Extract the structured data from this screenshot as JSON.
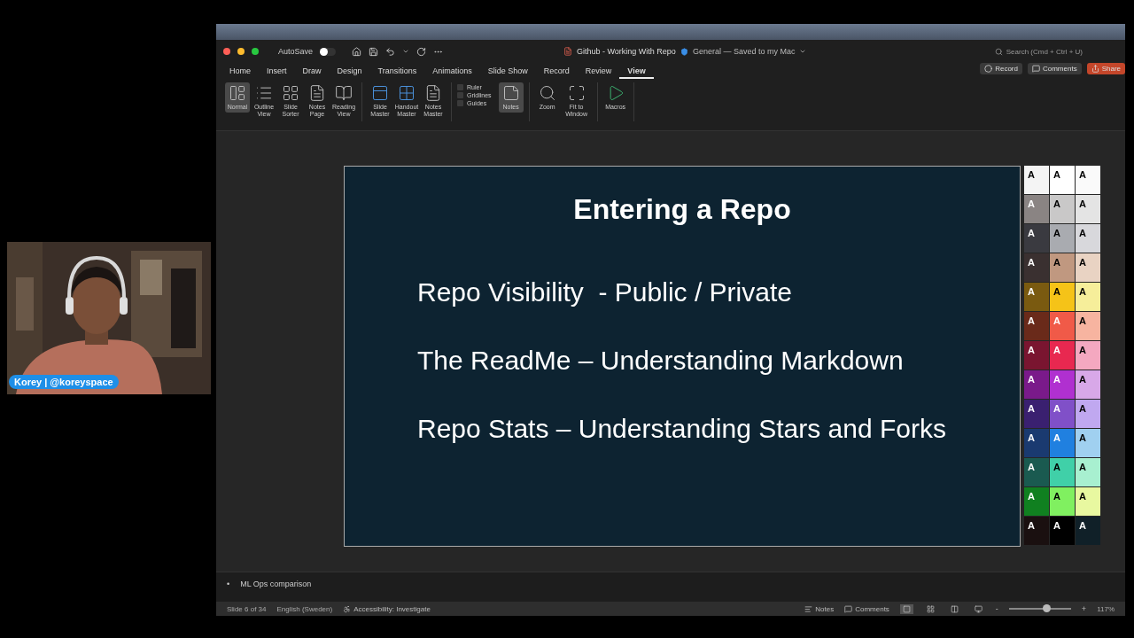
{
  "webcam": {
    "name_tag": "Korey | @koreyspace"
  },
  "window": {
    "title": "Github - Working With Repo",
    "location": "General — Saved to my Mac"
  },
  "autosave": {
    "label": "AutoSave",
    "on": false
  },
  "search": {
    "placeholder": "Search (Cmd + Ctrl + U)"
  },
  "actions": [
    {
      "label": "Record",
      "kind": "record"
    },
    {
      "label": "Comments",
      "kind": "comments"
    },
    {
      "label": "Share",
      "kind": "share"
    }
  ],
  "menu_tabs": [
    {
      "label": "Home",
      "selected": false
    },
    {
      "label": "Insert",
      "selected": false
    },
    {
      "label": "Draw",
      "selected": false
    },
    {
      "label": "Design",
      "selected": false
    },
    {
      "label": "Transitions",
      "selected": false
    },
    {
      "label": "Animations",
      "selected": false
    },
    {
      "label": "Slide Show",
      "selected": false
    },
    {
      "label": "Record",
      "selected": false
    },
    {
      "label": "Review",
      "selected": false
    },
    {
      "label": "View",
      "selected": true
    }
  ],
  "ribbon": [
    [
      {
        "kind": "button",
        "label": "Normal",
        "selected": true
      },
      {
        "kind": "button",
        "label": "Outline View",
        "selected": false
      },
      {
        "kind": "button",
        "label": "Slide Sorter",
        "selected": false
      },
      {
        "kind": "button",
        "label": "Notes Page",
        "selected": false
      },
      {
        "kind": "button",
        "label": "Reading View",
        "selected": false
      }
    ],
    [
      {
        "kind": "button",
        "label": "Slide Master",
        "selected": false
      },
      {
        "kind": "button",
        "label": "Handout Master",
        "selected": false
      },
      {
        "kind": "button",
        "label": "Notes Master",
        "selected": false
      }
    ],
    [
      {
        "kind": "checks",
        "items": [
          {
            "label": "Ruler",
            "checked": false
          },
          {
            "label": "Gridlines",
            "checked": false
          },
          {
            "label": "Guides",
            "checked": false
          }
        ]
      },
      {
        "kind": "button",
        "label": "Notes",
        "selected": true
      }
    ],
    [
      {
        "kind": "button",
        "label": "Zoom",
        "selected": false
      },
      {
        "kind": "button",
        "label": "Fit to Window",
        "selected": false
      }
    ],
    [
      {
        "kind": "button",
        "label": "Macros",
        "selected": false
      }
    ]
  ],
  "slide": {
    "title": "Entering a Repo",
    "bullets": [
      "Repo Visibility  - Public / Private",
      "The ReadMe – Understanding Markdown",
      "Repo Stats – Understanding Stars and Forks"
    ]
  },
  "swatch_rows": [
    [
      {
        "color": "#f4f4f4",
        "letter": "A"
      },
      {
        "color": "#ffffff",
        "letter": "A"
      },
      {
        "color": "#fafafa",
        "letter": "A"
      }
    ],
    [
      {
        "color": "#8a8483",
        "letter": "A"
      },
      {
        "color": "#c9c8c8",
        "letter": "A"
      },
      {
        "color": "#e4e4e4",
        "letter": "A"
      }
    ],
    [
      {
        "color": "#3a3a40",
        "letter": "A"
      },
      {
        "color": "#a9abb0",
        "letter": "A"
      },
      {
        "color": "#d8d8dc",
        "letter": "A"
      }
    ],
    [
      {
        "color": "#3a3030",
        "letter": "A"
      },
      {
        "color": "#c09880",
        "letter": "A"
      },
      {
        "color": "#e9d3c3",
        "letter": "A"
      }
    ],
    [
      {
        "color": "#7a5a10",
        "letter": "A"
      },
      {
        "color": "#f5c318",
        "letter": "A"
      },
      {
        "color": "#f6ee9a",
        "letter": "A"
      }
    ],
    [
      {
        "color": "#6a2a1a",
        "letter": "A"
      },
      {
        "color": "#f05a48",
        "letter": "A"
      },
      {
        "color": "#f7b4a0",
        "letter": "A"
      }
    ],
    [
      {
        "color": "#7a1530",
        "letter": "A"
      },
      {
        "color": "#e82850",
        "letter": "A"
      },
      {
        "color": "#f4a8c0",
        "letter": "A"
      }
    ],
    [
      {
        "color": "#7a1a8a",
        "letter": "A"
      },
      {
        "color": "#b030d0",
        "letter": "A"
      },
      {
        "color": "#d8a8e8",
        "letter": "A"
      }
    ],
    [
      {
        "color": "#3a2070",
        "letter": "A"
      },
      {
        "color": "#8050c8",
        "letter": "A"
      },
      {
        "color": "#c0a8f0",
        "letter": "A"
      }
    ],
    [
      {
        "color": "#1a3a70",
        "letter": "A"
      },
      {
        "color": "#2080e0",
        "letter": "A"
      },
      {
        "color": "#a0d0f0",
        "letter": "A"
      }
    ],
    [
      {
        "color": "#1a5a50",
        "letter": "A"
      },
      {
        "color": "#40d0a8",
        "letter": "A"
      },
      {
        "color": "#a8f0d0",
        "letter": "A"
      }
    ],
    [
      {
        "color": "#108020",
        "letter": "A"
      },
      {
        "color": "#80f060",
        "letter": "A"
      },
      {
        "color": "#e8f8a0",
        "letter": "A"
      }
    ],
    [
      {
        "color": "#1a1010",
        "letter": "A"
      },
      {
        "color": "#000000",
        "letter": "A"
      },
      {
        "color": "#102028",
        "letter": "A"
      }
    ]
  ],
  "notes": [
    {
      "bullet": "•",
      "text": "ML Ops comparison"
    }
  ],
  "status_bar": {
    "slide_info": "Slide 6 of 34",
    "language": "English (Sweden)",
    "accessibility": "Accessibility: Investigate",
    "notes_button": "Notes",
    "comments_button": "Comments",
    "views": [
      {
        "kind": "normal",
        "selected": true
      },
      {
        "kind": "sorter",
        "selected": false
      },
      {
        "kind": "reading",
        "selected": false
      },
      {
        "kind": "show",
        "selected": false
      }
    ],
    "zoom": {
      "minus": "-",
      "plus": "+",
      "level": 0.6,
      "reading": "117%"
    }
  }
}
